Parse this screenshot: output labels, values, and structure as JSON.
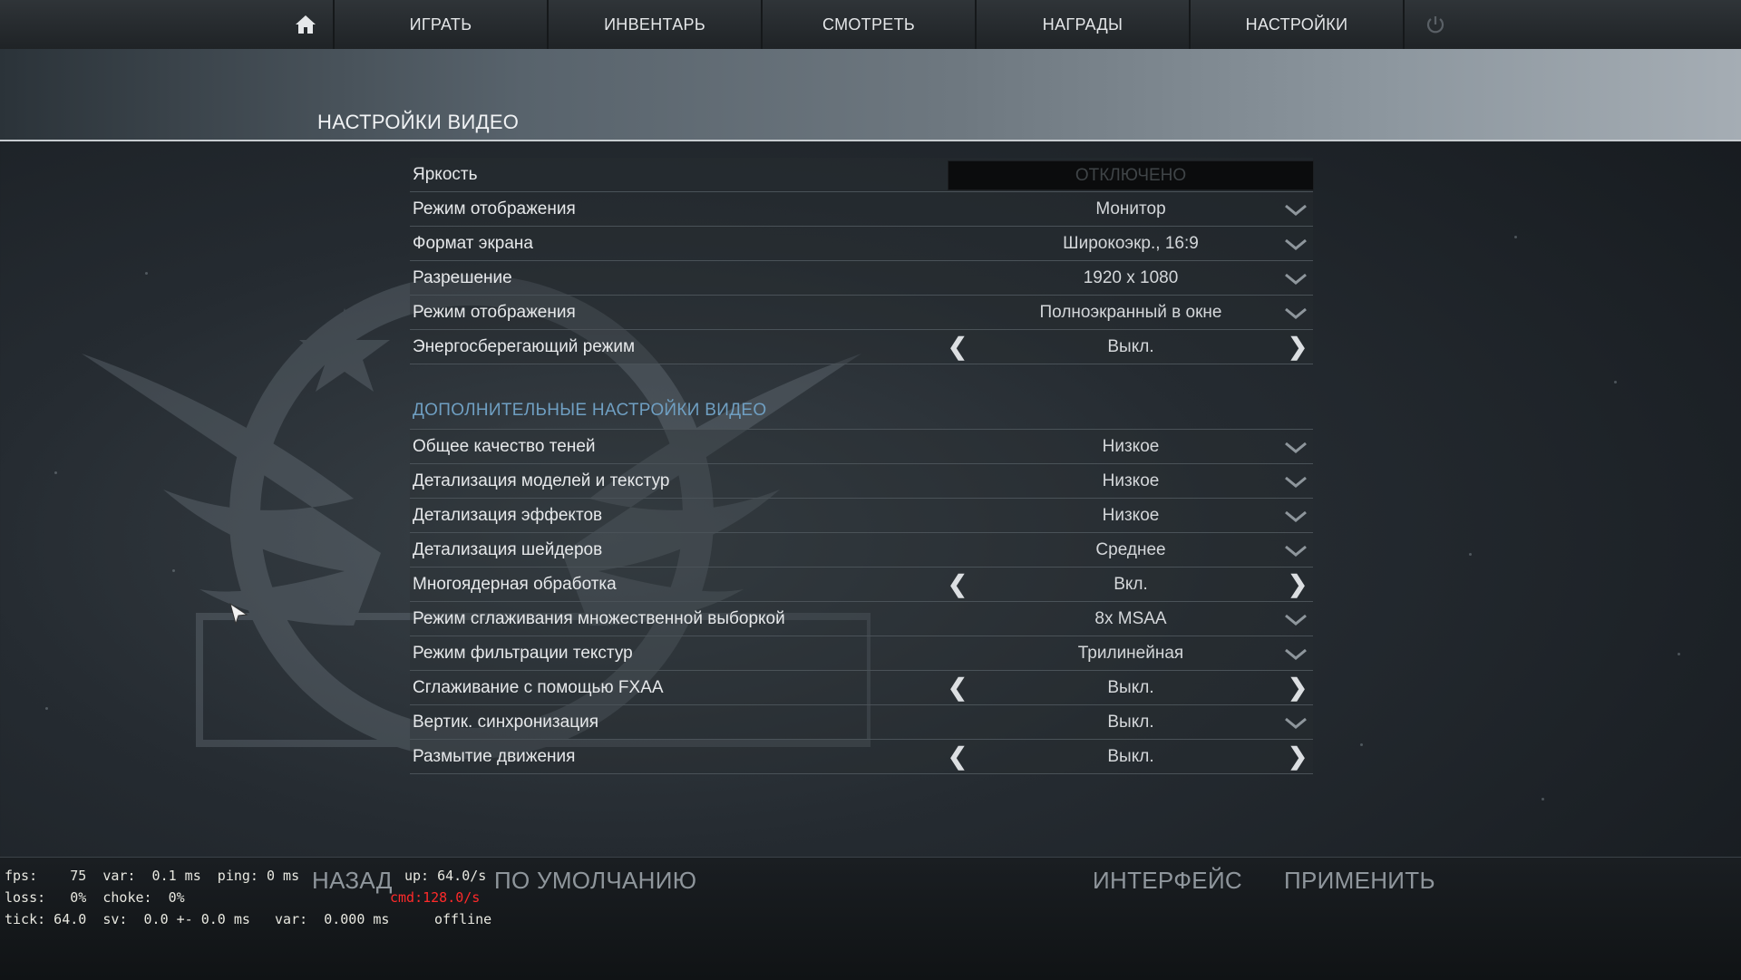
{
  "nav": {
    "items": [
      "ИГРАТЬ",
      "ИНВЕНТАРЬ",
      "СМОТРЕТЬ",
      "НАГРАДЫ",
      "НАСТРОЙКИ"
    ]
  },
  "page_title": "НАСТРОЙКИ ВИДЕО",
  "basic": {
    "brightness_label": "Яркость",
    "brightness_value": "ОТКЛЮЧЕНО",
    "rows": [
      {
        "label": "Режим отображения",
        "value": "Монитор",
        "control": "dropdown"
      },
      {
        "label": "Формат экрана",
        "value": "Широкоэкр., 16:9",
        "control": "dropdown"
      },
      {
        "label": "Разрешение",
        "value": "1920 x 1080",
        "control": "dropdown"
      },
      {
        "label": "Режим отображения",
        "value": "Полноэкранный в окне",
        "control": "dropdown"
      },
      {
        "label": "Энергосберегающий режим",
        "value": "Выкл.",
        "control": "arrows"
      }
    ]
  },
  "advanced": {
    "title": "ДОПОЛНИТЕЛЬНЫЕ НАСТРОЙКИ ВИДЕО",
    "rows": [
      {
        "label": "Общее качество теней",
        "value": "Низкое",
        "control": "dropdown"
      },
      {
        "label": "Детализация моделей и текстур",
        "value": "Низкое",
        "control": "dropdown"
      },
      {
        "label": "Детализация эффектов",
        "value": "Низкое",
        "control": "dropdown"
      },
      {
        "label": "Детализация шейдеров",
        "value": "Среднее",
        "control": "dropdown"
      },
      {
        "label": "Многоядерная обработка",
        "value": "Вкл.",
        "control": "arrows"
      },
      {
        "label": "Режим сглаживания множественной выборкой",
        "value": "8x MSAA",
        "control": "dropdown"
      },
      {
        "label": "Режим фильтрации текстур",
        "value": "Трилинейная",
        "control": "dropdown"
      },
      {
        "label": "Сглаживание с помощью FXAA",
        "value": "Выкл.",
        "control": "arrows"
      },
      {
        "label": "Вертик. синхронизация",
        "value": "Выкл.",
        "control": "dropdown"
      },
      {
        "label": "Размытие движения",
        "value": "Выкл.",
        "control": "arrows"
      }
    ]
  },
  "bottom": {
    "back": "НАЗАД",
    "defaults": "ПО УМОЛЧАНИЮ",
    "interface": "ИНТЕРФЕЙС",
    "apply": "ПРИМЕНИТЬ"
  },
  "netgraph": {
    "line1": "fps:    75  var:  0.1 ms  ping: 0 ms",
    "line2": "loss:   0%  choke:  0%",
    "line3": "tick: 64.0  sv:  0.0 +- 0.0 ms   var:  0.000 ms",
    "up": "up: 64.0/s",
    "cmd": "cmd:128.0/s",
    "status": "offline"
  },
  "colors": {
    "accent_section": "#6f9fc2",
    "netgraph_warning": "#ff2a2a"
  },
  "icons": [
    "home-icon",
    "power-icon",
    "chevron-down-icon",
    "arrow-left-icon",
    "arrow-right-icon",
    "cursor-icon"
  ]
}
